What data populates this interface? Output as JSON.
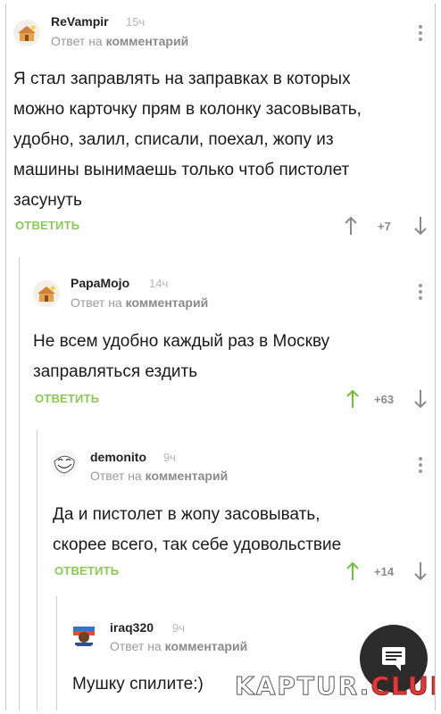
{
  "comments": [
    {
      "author": "ReVampir",
      "time": "15ч",
      "reply_prefix": "Ответ на",
      "reply_target": "комментарий",
      "text_lines": [
        "Я стал заправлять на заправках в которых",
        "можно карточку прям в колонку засовывать,",
        "удобно, залил, списали, поехал, жопу из",
        "машины вынимаешь только чтоб пистолет",
        "засунуть"
      ],
      "reply_label": "ОТВЕТИТЬ",
      "rating": "+7",
      "avatar_icon": "beehive-avatar-icon"
    },
    {
      "author": "PapaMojo",
      "time": "14ч",
      "reply_prefix": "Ответ на",
      "reply_target": "комментарий",
      "text_lines": [
        "Не всем удобно каждый раз в Москву",
        "заправляться ездить"
      ],
      "reply_label": "ОТВЕТИТЬ",
      "rating": "+63",
      "upvoted": true,
      "avatar_icon": "beehive-avatar-icon"
    },
    {
      "author": "demonito",
      "time": "9ч",
      "reply_prefix": "Ответ на",
      "reply_target": "комментарий",
      "text_lines": [
        "Да и пистолет в жопу засовывать,",
        "скорее всего, так себе удовольствие"
      ],
      "reply_label": "ОТВЕТИТЬ",
      "rating": "+14",
      "upvoted": true,
      "avatar_icon": "troll-face-avatar-icon"
    },
    {
      "author": "iraq320",
      "time": "9ч",
      "reply_prefix": "Ответ на",
      "reply_target": "комментарий",
      "text_lines": [
        "Мушку спилите:)"
      ],
      "avatar_icon": "bear-logo-avatar-icon"
    }
  ],
  "watermark": {
    "main": "KAPTUR.",
    "accent": "CLUB"
  },
  "colors": {
    "accent_green": "#8ac858",
    "muted": "#9a9a9a",
    "fab": "#2b2b2b"
  }
}
